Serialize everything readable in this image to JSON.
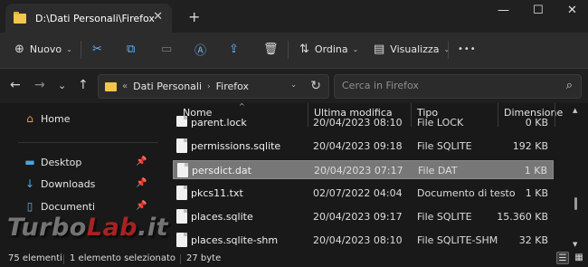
{
  "window": {
    "tab_title": "D:\\Dati Personali\\Firefox",
    "tab_close": "✕",
    "new_tab": "+",
    "minimize": "—",
    "maximize": "☐",
    "close": "✕"
  },
  "toolbar": {
    "new_icon": "⊕",
    "new_label": "Nuovo",
    "cut_icon": "✂",
    "copy_icon": "⧉",
    "paste_icon": "▭",
    "rename_icon": "Ⓐ",
    "share_icon": "⇪",
    "delete_icon": "🗑",
    "sort_icon": "⇅",
    "sort_label": "Ordina",
    "view_icon": "▤",
    "view_label": "Visualizza",
    "more_icon": "•••",
    "chevron": "⌄"
  },
  "nav": {
    "back": "←",
    "forward": "→",
    "recent": "⌄",
    "up": "↑",
    "overflow": "«",
    "crumbs": [
      "Dati Personali",
      "Firefox"
    ],
    "crumb_sep": "›",
    "dropdown": "⌄",
    "refresh": "↻"
  },
  "search": {
    "placeholder": "Cerca in Firefox",
    "icon": "⌕"
  },
  "sidebar": {
    "items": [
      {
        "label": "Home",
        "icon": "⌂",
        "pinned": false
      },
      {
        "label": "Desktop",
        "icon": "▬",
        "pinned": true
      },
      {
        "label": "Downloads",
        "icon": "↓",
        "pinned": true
      },
      {
        "label": "Documenti",
        "icon": "▯",
        "pinned": true
      }
    ],
    "pin_icon": "📌"
  },
  "columns": {
    "name": "Nome",
    "modified": "Ultima modifica",
    "type": "Tipo",
    "size": "Dimensione",
    "sort_arrow": "^"
  },
  "files": [
    {
      "name": "parent.lock",
      "modified": "20/04/2023 08:10",
      "type": "File LOCK",
      "size": "0 KB"
    },
    {
      "name": "permissions.sqlite",
      "modified": "20/04/2023 09:18",
      "type": "File SQLITE",
      "size": "192 KB"
    },
    {
      "name": "persdict.dat",
      "modified": "20/04/2023 07:17",
      "type": "File DAT",
      "size": "1 KB",
      "selected": true
    },
    {
      "name": "pkcs11.txt",
      "modified": "02/07/2022 04:04",
      "type": "Documento di testo",
      "size": "1 KB"
    },
    {
      "name": "places.sqlite",
      "modified": "20/04/2023 09:17",
      "type": "File SQLITE",
      "size": "15.360 KB"
    },
    {
      "name": "places.sqlite-shm",
      "modified": "20/04/2023 08:10",
      "type": "File SQLITE-SHM",
      "size": "32 KB"
    }
  ],
  "status": {
    "count": "75 elementi",
    "selection": "1 elemento selezionato",
    "size": "27 byte",
    "details_view_icon": "☰",
    "tiles_view_icon": "▦"
  },
  "watermark": {
    "part1": "Turbo",
    "part2": "Lab",
    "part3": ".it"
  },
  "colors": {
    "accent": "#6ab0f0",
    "folder": "#f4c64a",
    "background": "#191919",
    "selection": "#777777"
  }
}
